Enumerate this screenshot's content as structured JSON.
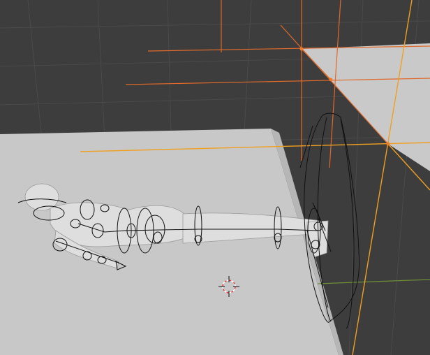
{
  "app": {
    "name": "3D Viewport"
  },
  "viewport": {
    "background_color": "#3d3d3d",
    "grid_color": "#4a4a4a",
    "floor_color": "#c8c8c8",
    "selection_color": "#e06a2a",
    "active_selection_color": "#f0a020",
    "x_axis_color": "#6d8f35",
    "rig_outline_color": "#111111",
    "objects": [
      {
        "name": "floor-plane",
        "icon": "mesh-icon"
      },
      {
        "name": "selected-plane",
        "state": "selected"
      },
      {
        "name": "character-body",
        "pose": "lying-prone"
      },
      {
        "name": "armature-rig",
        "display": "wire"
      },
      {
        "name": "camera-frame",
        "display": "wire"
      }
    ],
    "cursor": {
      "icon": "3d-cursor-icon",
      "color": "#d84040"
    }
  }
}
